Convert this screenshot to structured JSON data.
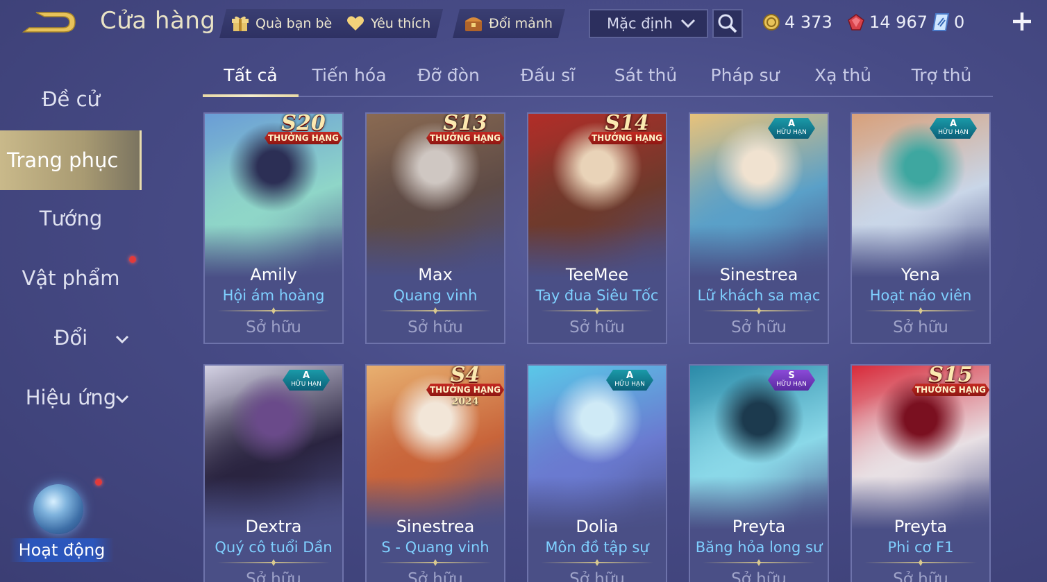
{
  "header": {
    "title": "Cửa hàng",
    "buttons": [
      {
        "label": "Quà bạn bè",
        "icon": "gift-icon"
      },
      {
        "label": "Yêu thích",
        "icon": "heart-icon"
      },
      {
        "label": "Đổi mảnh",
        "icon": "chest-icon"
      }
    ],
    "sort": {
      "value": "Mặc định"
    },
    "currencies": [
      {
        "icon": "gold-coin-icon",
        "amount": "4 373"
      },
      {
        "icon": "voucher-gem-icon",
        "amount": "14 967"
      },
      {
        "icon": "quan-huy-icon",
        "amount": "0"
      }
    ]
  },
  "sidebar": {
    "items": [
      {
        "label": "Đề cử"
      },
      {
        "label": "Trang phục"
      },
      {
        "label": "Tướng"
      },
      {
        "label": "Vật phẩm"
      },
      {
        "label": "Đổi"
      },
      {
        "label": "Hiệu ứng"
      }
    ],
    "activity_label": "Hoạt động"
  },
  "tabs": [
    "Tất cả",
    "Tiến hóa",
    "Đỡ đòn",
    "Đấu sĩ",
    "Sát thủ",
    "Pháp sư",
    "Xạ thủ",
    "Trợ thủ"
  ],
  "cards": [
    {
      "hero": "Amily",
      "skin": "Hội ám hoàng",
      "status": "Sở hữu",
      "badge_type": "rank",
      "badge_main": "S20",
      "badge_sub": "THƯỞNG HẠNG",
      "badge_year": "",
      "art_colors": [
        "#6a9dd6",
        "#2c2f55",
        "#8fd6c8"
      ]
    },
    {
      "hero": "Max",
      "skin": "Quang vinh",
      "status": "Sở hữu",
      "badge_type": "rank",
      "badge_main": "S13",
      "badge_sub": "THƯỞNG HẠNG",
      "badge_year": "",
      "art_colors": [
        "#8a6a52",
        "#cfc7c2",
        "#5e4b46"
      ]
    },
    {
      "hero": "TeeMee",
      "skin": "Tay đua Siêu Tốc",
      "status": "Sở hữu",
      "badge_type": "rank",
      "badge_main": "S14",
      "badge_sub": "THƯỞNG HẠNG",
      "badge_year": "",
      "art_colors": [
        "#b22d28",
        "#e9d3b8",
        "#6e3a2c"
      ]
    },
    {
      "hero": "Sinestrea",
      "skin": "Lữ khách sa mạc",
      "status": "Sở hữu",
      "badge_type": "limited",
      "badge_main": "A",
      "badge_sub": "HỮU HẠN",
      "badge_year": "",
      "art_colors": [
        "#e8c27a",
        "#f0e2d0",
        "#5aa0c8"
      ]
    },
    {
      "hero": "Yena",
      "skin": "Hoạt náo viên",
      "status": "Sở hữu",
      "badge_type": "limited",
      "badge_main": "A",
      "badge_sub": "HỮU HẠN",
      "badge_year": "",
      "art_colors": [
        "#d8a07a",
        "#3ea7a0",
        "#c9d6e8"
      ]
    },
    {
      "hero": "Dextra",
      "skin": "Quý cô tuổi Dần",
      "status": "Sở hữu",
      "badge_type": "limited",
      "badge_main": "A",
      "badge_sub": "HỮU HẠN",
      "badge_year": "",
      "art_colors": [
        "#d4d2e4",
        "#6a4a8a",
        "#2a2440"
      ]
    },
    {
      "hero": "Sinestrea",
      "skin": "S - Quang vinh",
      "status": "Sở hữu",
      "badge_type": "rank",
      "badge_main": "S4",
      "badge_sub": "THƯỞNG HẠNG",
      "badge_year": "2024",
      "art_colors": [
        "#e8b070",
        "#f2e6d8",
        "#c8643a"
      ]
    },
    {
      "hero": "Dolia",
      "skin": "Môn đồ tập sự",
      "status": "Sở hữu",
      "badge_type": "limited",
      "badge_main": "A",
      "badge_sub": "HỮU HẠN",
      "badge_year": "",
      "art_colors": [
        "#5ac8e8",
        "#cfeaf6",
        "#6a7ad0"
      ]
    },
    {
      "hero": "Preyta",
      "skin": "Băng hỏa long sư",
      "status": "Sở hữu",
      "badge_type": "limited-purple",
      "badge_main": "S",
      "badge_sub": "HỮU HẠN",
      "badge_year": "",
      "art_colors": [
        "#2a8aa8",
        "#1c3a4e",
        "#8ad8e8"
      ]
    },
    {
      "hero": "Preyta",
      "skin": "Phi cơ F1",
      "status": "Sở hữu",
      "badge_type": "rank",
      "badge_main": "S15",
      "badge_sub": "THƯỞNG HẠNG",
      "badge_year": "",
      "art_colors": [
        "#d82a3a",
        "#7a1020",
        "#e8e0e4"
      ]
    }
  ]
}
